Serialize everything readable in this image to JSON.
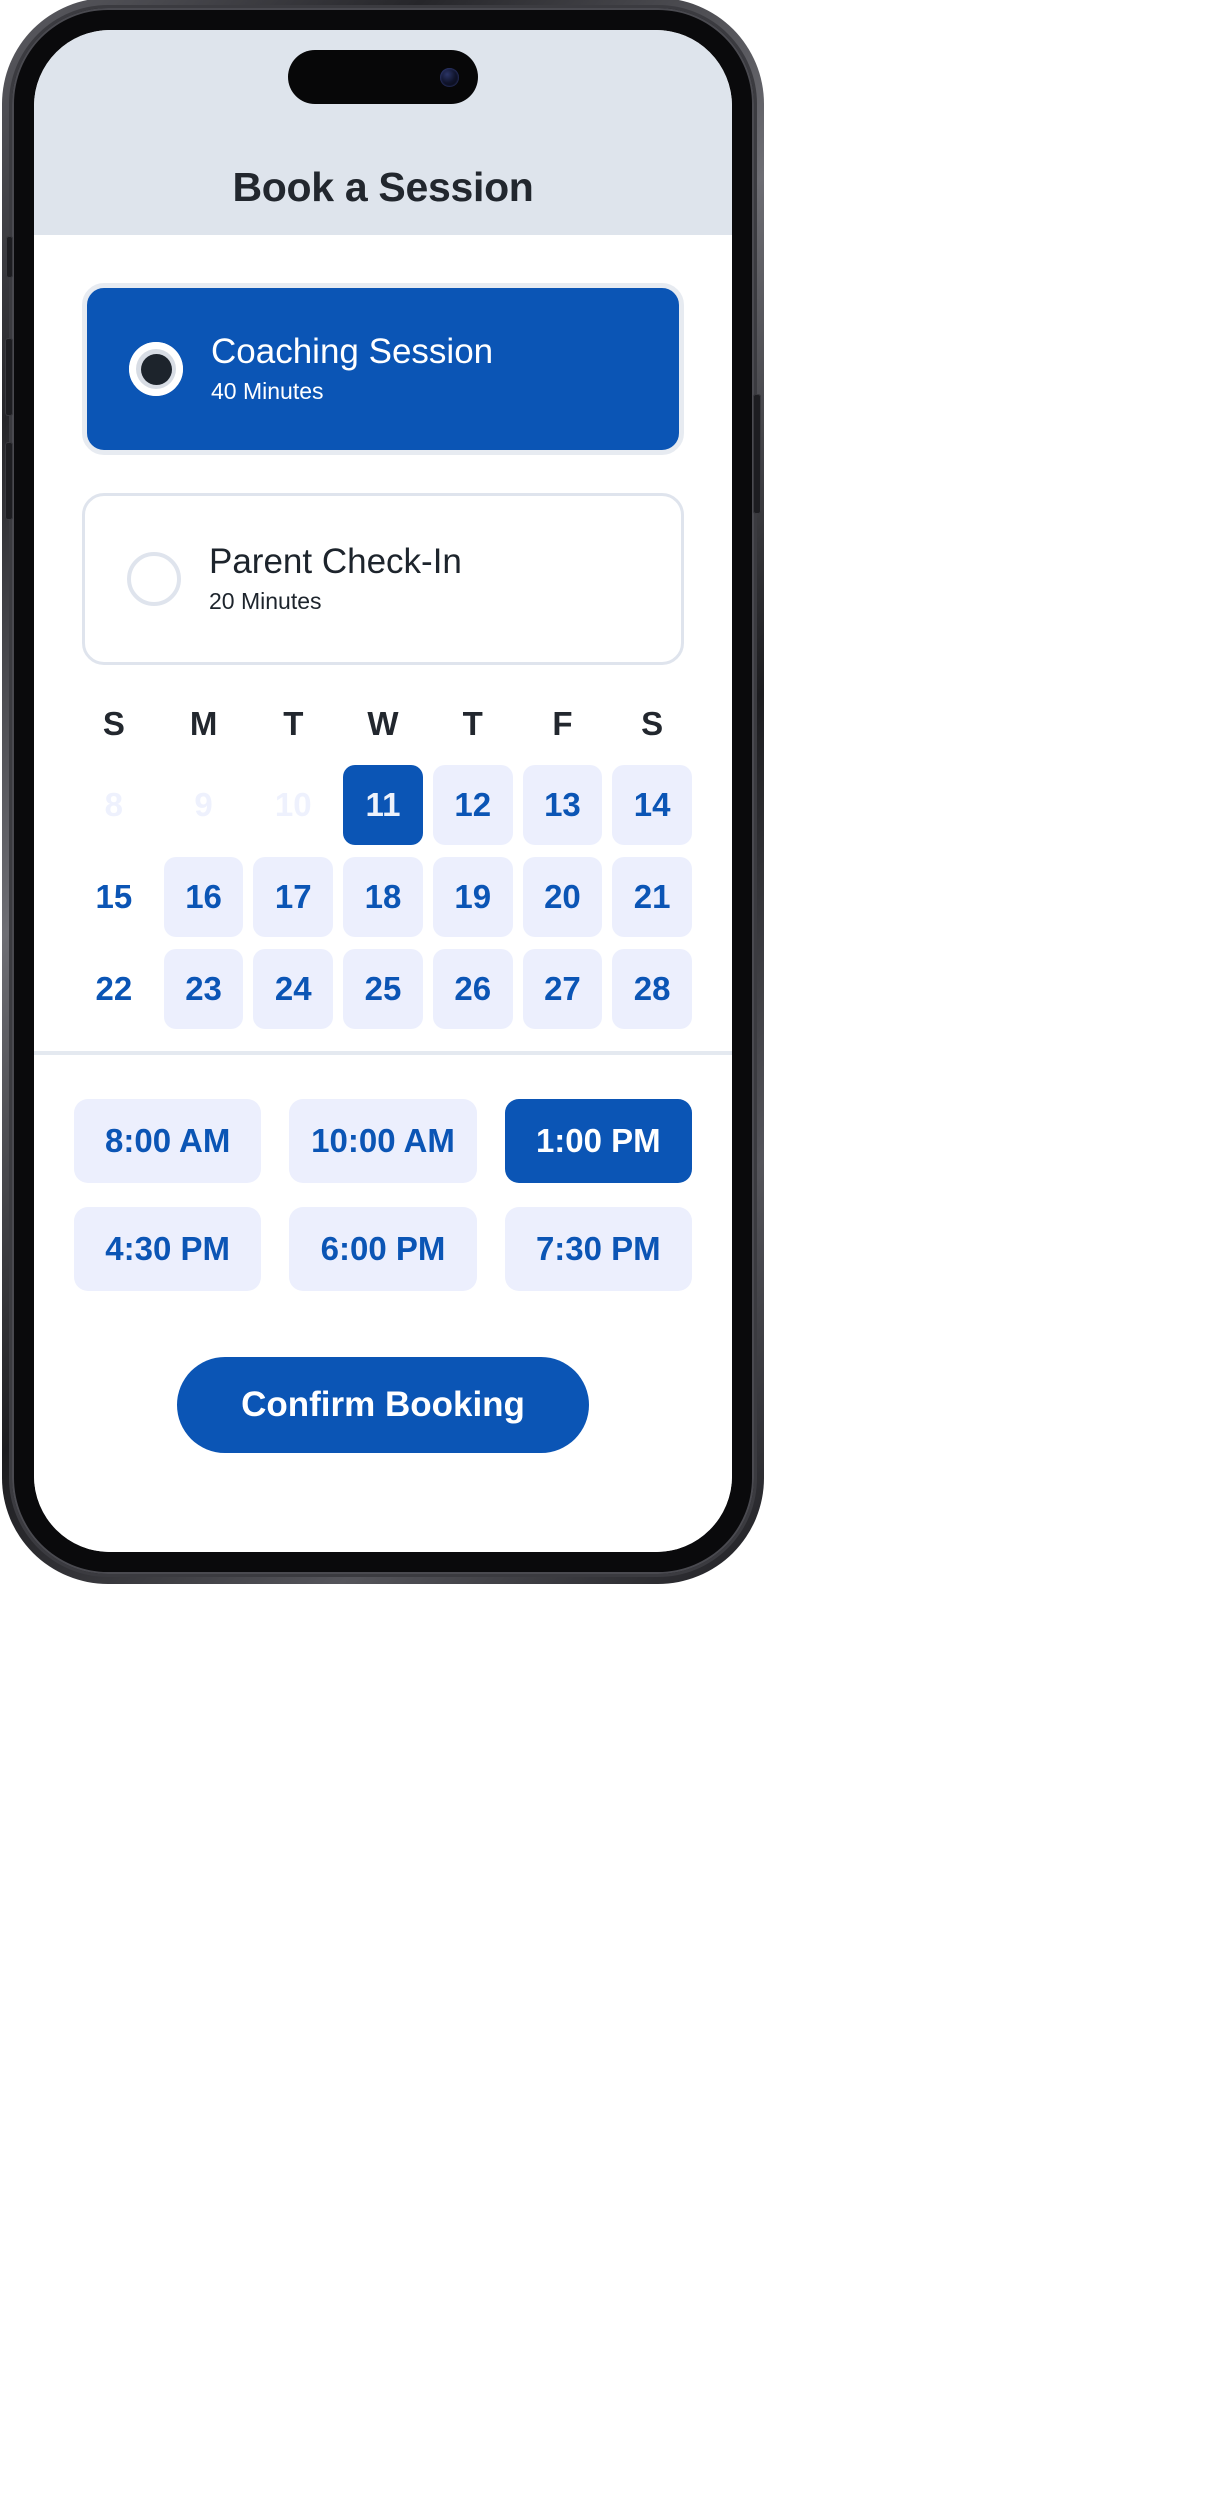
{
  "header": {
    "title": "Book a Session"
  },
  "session_options": [
    {
      "title": "Coaching Session",
      "duration": "40 Minutes",
      "selected": true
    },
    {
      "title": "Parent Check-In",
      "duration": "20 Minutes",
      "selected": false
    }
  ],
  "calendar": {
    "weekday_headers": [
      "S",
      "M",
      "T",
      "W",
      "T",
      "F",
      "S"
    ],
    "weeks": [
      [
        {
          "day": "8",
          "state": "disabled"
        },
        {
          "day": "9",
          "state": "disabled"
        },
        {
          "day": "10",
          "state": "disabled"
        },
        {
          "day": "11",
          "state": "selected"
        },
        {
          "day": "12",
          "state": "avail"
        },
        {
          "day": "13",
          "state": "avail"
        },
        {
          "day": "14",
          "state": "avail"
        }
      ],
      [
        {
          "day": "15",
          "state": "plain"
        },
        {
          "day": "16",
          "state": "avail"
        },
        {
          "day": "17",
          "state": "avail"
        },
        {
          "day": "18",
          "state": "avail"
        },
        {
          "day": "19",
          "state": "avail"
        },
        {
          "day": "20",
          "state": "avail"
        },
        {
          "day": "21",
          "state": "avail"
        }
      ],
      [
        {
          "day": "22",
          "state": "plain"
        },
        {
          "day": "23",
          "state": "avail"
        },
        {
          "day": "24",
          "state": "avail"
        },
        {
          "day": "25",
          "state": "avail"
        },
        {
          "day": "26",
          "state": "avail"
        },
        {
          "day": "27",
          "state": "avail"
        },
        {
          "day": "28",
          "state": "avail"
        }
      ]
    ]
  },
  "time_slots": [
    {
      "label": "8:00 AM",
      "selected": false
    },
    {
      "label": "10:00 AM",
      "selected": false
    },
    {
      "label": "1:00 PM",
      "selected": true
    },
    {
      "label": "4:30 PM",
      "selected": false
    },
    {
      "label": "6:00 PM",
      "selected": false
    },
    {
      "label": "7:30 PM",
      "selected": false
    }
  ],
  "confirm": {
    "label": "Confirm Booking"
  },
  "colors": {
    "accent": "#0b55b5",
    "header_bg": "#dee4ec",
    "chip_bg": "#eceffd",
    "text_dark": "#22272e",
    "border_light": "#dfe4ed"
  }
}
